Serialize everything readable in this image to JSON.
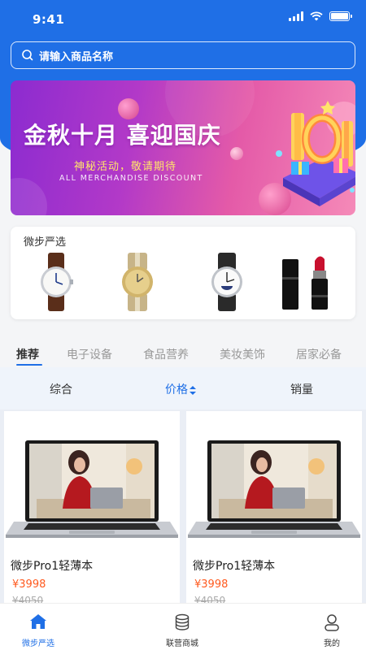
{
  "status_bar": {
    "time": "9:41",
    "battery_level": 1.0
  },
  "search": {
    "placeholder": "请输入商品名称"
  },
  "banner": {
    "title": "金秋十月  喜迎国庆",
    "subtitle": "神秘活动，敬请期待",
    "english": "ALL MERCHANDISE DISCOUNT"
  },
  "picks": {
    "title": "微步严选",
    "items": [
      {
        "icon": "watch-leather-icon"
      },
      {
        "icon": "watch-gold-icon"
      },
      {
        "icon": "watch-moonphase-icon"
      },
      {
        "icon": "lipstick-icon"
      }
    ]
  },
  "category_tabs": [
    {
      "label": "推荐",
      "active": true
    },
    {
      "label": "电子设备",
      "active": false
    },
    {
      "label": "食品营养",
      "active": false
    },
    {
      "label": "美妆美饰",
      "active": false
    },
    {
      "label": "居家必备",
      "active": false
    }
  ],
  "sort_bar": {
    "items": [
      {
        "label": "综合",
        "active": false
      },
      {
        "label": "价格",
        "active": true
      },
      {
        "label": "销量",
        "active": false
      }
    ]
  },
  "products": [
    {
      "title": "微步Pro1轻薄本",
      "price": "¥3998",
      "old_price": "¥4050"
    },
    {
      "title": "微步Pro1轻薄本",
      "price": "¥3998",
      "old_price": "¥4050"
    }
  ],
  "tab_bar": {
    "items": [
      {
        "label": "微步严选",
        "icon": "home-icon",
        "active": true
      },
      {
        "label": "联营商城",
        "icon": "database-icon",
        "active": false
      },
      {
        "label": "我的",
        "icon": "user-icon",
        "active": false
      }
    ]
  },
  "colors": {
    "primary": "#1f6fe6",
    "price": "#ff5a1f"
  }
}
